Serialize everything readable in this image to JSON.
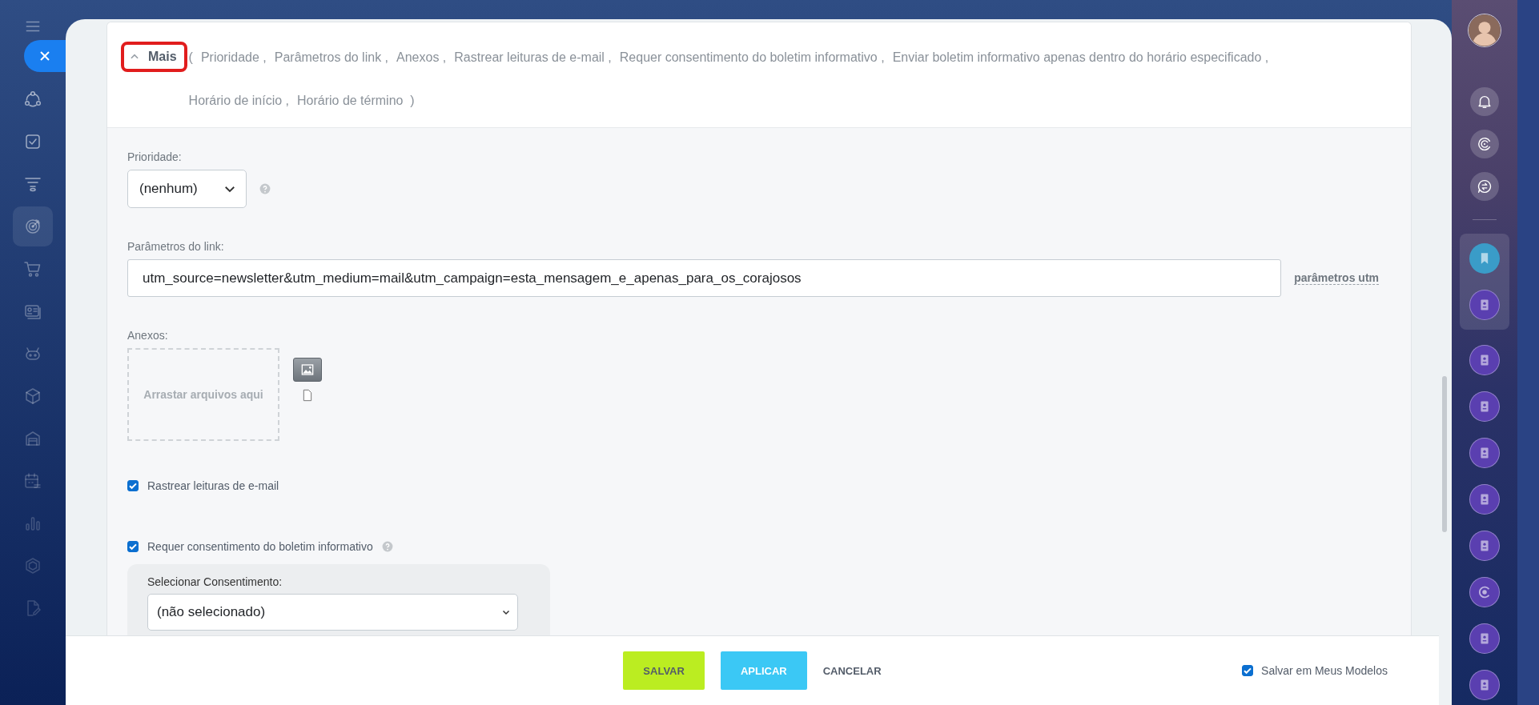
{
  "left_nav": {
    "items": [
      {
        "selected": false
      },
      {
        "selected": false
      },
      {
        "selected": false
      },
      {
        "selected": true
      },
      {
        "selected": false
      },
      {
        "selected": false
      },
      {
        "selected": false
      },
      {
        "selected": false
      },
      {
        "selected": false
      },
      {
        "selected": false
      },
      {
        "selected": false
      },
      {
        "selected": false
      },
      {
        "selected": false
      }
    ]
  },
  "more_section": {
    "toggle": {
      "label": "Mais",
      "expanded": true,
      "highlighted": true
    },
    "open_paren": "(",
    "items": [
      "Prioridade ,",
      "Parâmetros do link ,",
      "Anexos ,",
      "Rastrear leituras de e-mail ,",
      "Requer consentimento do boletim informativo ,",
      "Enviar boletim informativo apenas dentro do horário especificado ,",
      "Horário de início ,",
      "Horário de término"
    ],
    "close_paren": ")"
  },
  "priority": {
    "label": "Prioridade:",
    "value": "(nenhum)"
  },
  "link_params": {
    "label": "Parâmetros do link:",
    "value": "utm_source=newsletter&utm_medium=mail&utm_campaign=esta_mensagem_e_apenas_para_os_corajosos",
    "link": "parâmetros utm"
  },
  "attachments": {
    "label": "Anexos:",
    "dropzone": "Arrastar arquivos aqui"
  },
  "track_reads": {
    "label": "Rastrear leituras de e-mail",
    "checked": true
  },
  "consent": {
    "label": "Requer consentimento do boletim informativo",
    "checked": true,
    "select_label": "Selecionar Consentimento:",
    "select_value": "(não selecionado)"
  },
  "footer": {
    "buttons": [
      {
        "label": "SALVAR",
        "kind": "primary"
      },
      {
        "label": "APLICAR",
        "kind": "secondary"
      },
      {
        "label": "CANCELAR",
        "kind": "link"
      }
    ],
    "save_template": {
      "label": "Salvar em Meus Modelos",
      "checked": true
    }
  }
}
